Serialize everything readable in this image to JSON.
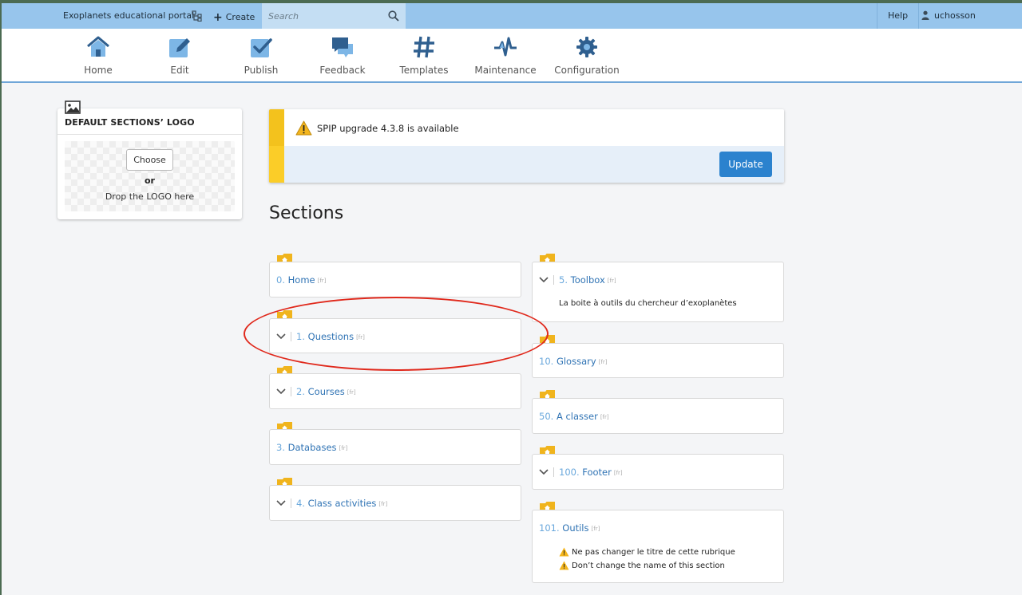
{
  "topbar": {
    "site_name": "Exoplanets educational portal",
    "create_label": "Create",
    "search_placeholder": "Search",
    "help_label": "Help",
    "username": "uchosson"
  },
  "nav": {
    "items": [
      {
        "label": "Home",
        "icon": "home-icon"
      },
      {
        "label": "Edit",
        "icon": "edit-icon"
      },
      {
        "label": "Publish",
        "icon": "publish-icon"
      },
      {
        "label": "Feedback",
        "icon": "feedback-icon"
      },
      {
        "label": "Templates",
        "icon": "templates-icon"
      },
      {
        "label": "Maintenance",
        "icon": "maintenance-icon"
      },
      {
        "label": "Configuration",
        "icon": "gear-icon"
      }
    ]
  },
  "logo_box": {
    "title": "DEFAULT SECTIONS’ LOGO",
    "choose_label": "Choose",
    "or_label": "or",
    "drop_label": "Drop the LOGO here"
  },
  "alert": {
    "message": "SPIP upgrade 4.3.8 is available",
    "update_label": "Update"
  },
  "sections_title": "Sections",
  "sections_left": [
    {
      "num": "0.",
      "name": "Home",
      "lang": "[fr]",
      "expandable": false
    },
    {
      "num": "1.",
      "name": "Questions",
      "lang": "[fr]",
      "expandable": true
    },
    {
      "num": "2.",
      "name": "Courses",
      "lang": "[fr]",
      "expandable": true
    },
    {
      "num": "3.",
      "name": "Databases",
      "lang": "[fr]",
      "expandable": false
    },
    {
      "num": "4.",
      "name": "Class activities",
      "lang": "[fr]",
      "expandable": true
    }
  ],
  "sections_right": [
    {
      "num": "5.",
      "name": "Toolbox",
      "lang": "[fr]",
      "expandable": true,
      "description": "La boite à outils du chercheur d’exoplanètes"
    },
    {
      "num": "10.",
      "name": "Glossary",
      "lang": "[fr]",
      "expandable": false
    },
    {
      "num": "50.",
      "name": "A classer",
      "lang": "[fr]",
      "expandable": false
    },
    {
      "num": "100.",
      "name": "Footer",
      "lang": "[fr]",
      "expandable": true
    },
    {
      "num": "101.",
      "name": "Outils",
      "lang": "[fr]",
      "expandable": false,
      "notes": [
        "Ne pas changer le titre de cette rubrique",
        "Don’t change the name of this section"
      ]
    }
  ],
  "colors": {
    "topbar": "#97c5ec",
    "accent": "#2b82ce",
    "warning": "#f3c21d",
    "annotation": "#e0291c"
  }
}
